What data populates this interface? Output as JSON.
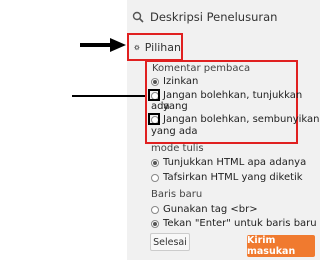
{
  "sidebar": {
    "description_label": "Deskripsi Penelusuran",
    "options_label": "Pilihan"
  },
  "comments": {
    "section_label": "Komentar pembaca",
    "options": [
      {
        "label": "Izinkan",
        "checked": true
      },
      {
        "label_line1": "Jangan bolehkan, tunjukkan yang",
        "label_line2": "ada",
        "checked": false
      },
      {
        "label_line1": "Jangan bolehkan, sembunyikan",
        "label_line2": "yang ada",
        "checked": false
      }
    ]
  },
  "compose_mode": {
    "section_label": "mode tulis",
    "options": [
      {
        "label": "Tunjukkan HTML apa adanya",
        "checked": true
      },
      {
        "label": "Tafsirkan HTML yang diketik",
        "checked": false
      }
    ]
  },
  "line_breaks": {
    "section_label": "Baris baru",
    "options": [
      {
        "label": "Gunakan tag <br>",
        "checked": false
      },
      {
        "label": "Tekan \"Enter\" untuk baris baru",
        "checked": true
      }
    ]
  },
  "buttons": {
    "done": "Selesai",
    "submit": "Kirim masukan"
  },
  "colors": {
    "highlight_red": "#e02020",
    "submit_orange": "#f07a2f"
  }
}
